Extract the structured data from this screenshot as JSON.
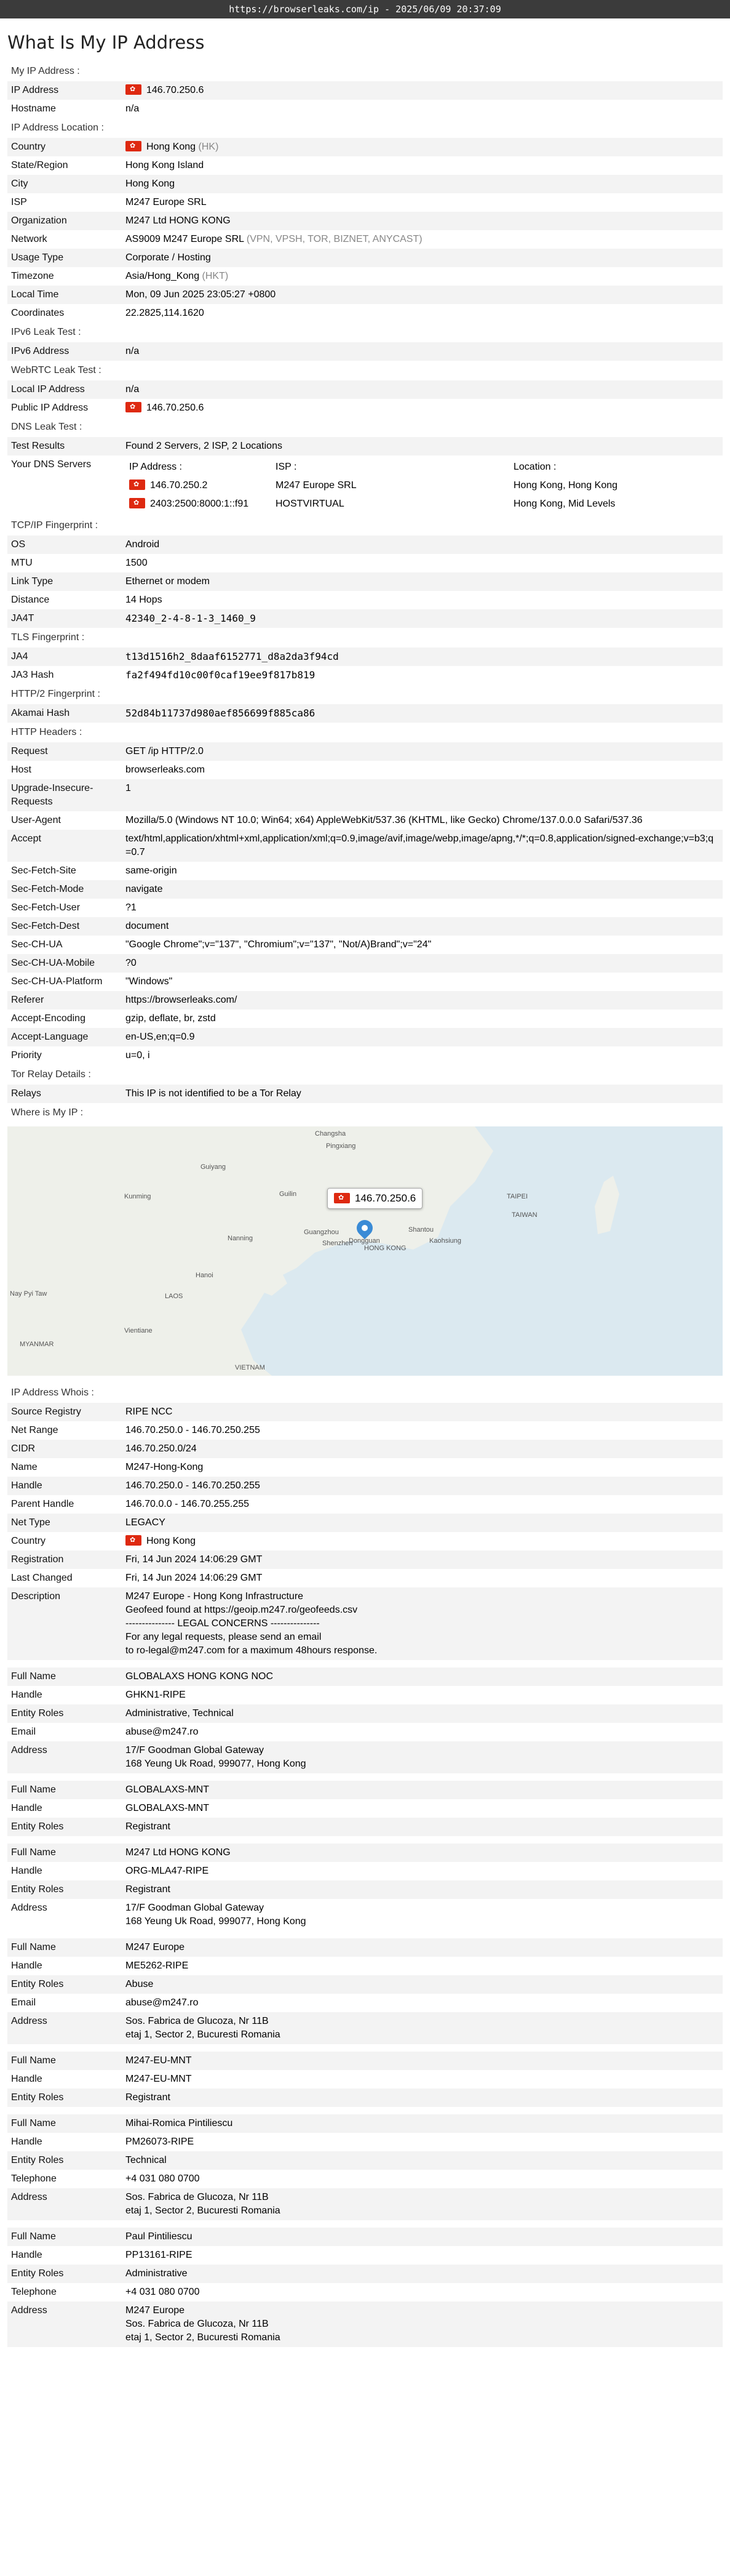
{
  "url_bar": "https://browserleaks.com/ip - 2025/06/09 20:37:09",
  "title": "What Is My IP Address",
  "s_myip": {
    "title": "My IP Address :",
    "ip_label": "IP Address",
    "ip": "146.70.250.6",
    "host_label": "Hostname",
    "host": "n/a"
  },
  "s_loc": {
    "title": "IP Address Location :",
    "country_label": "Country",
    "country": "Hong Kong",
    "country_code": "(HK)",
    "state_label": "State/Region",
    "state": "Hong Kong Island",
    "city_label": "City",
    "city": "Hong Kong",
    "isp_label": "ISP",
    "isp": "M247 Europe SRL",
    "org_label": "Organization",
    "org": "M247 Ltd HONG KONG",
    "net_label": "Network",
    "net": "AS9009 M247 Europe SRL",
    "net_tags": "(VPN, VPSH, TOR, BIZNET, ANYCAST)",
    "usage_label": "Usage Type",
    "usage": "Corporate / Hosting",
    "tz_label": "Timezone",
    "tz": "Asia/Hong_Kong",
    "tz_abbr": "(HKT)",
    "lt_label": "Local Time",
    "lt": "Mon, 09 Jun 2025 23:05:27 +0800",
    "coord_label": "Coordinates",
    "coord": "22.2825,114.1620"
  },
  "s_v6": {
    "title": "IPv6 Leak Test :",
    "label": "IPv6 Address",
    "value": "n/a"
  },
  "s_rtc": {
    "title": "WebRTC Leak Test :",
    "local_label": "Local IP Address",
    "local": "n/a",
    "public_label": "Public IP Address",
    "public": "146.70.250.6"
  },
  "s_dns": {
    "title": "DNS Leak Test :",
    "results_label": "Test Results",
    "results": "Found 2 Servers, 2 ISP, 2 Locations",
    "servers_label": "Your DNS Servers",
    "h_ip": "IP Address :",
    "h_isp": "ISP :",
    "h_loc": "Location :",
    "rows": [
      {
        "ip": "146.70.250.2",
        "isp": "M247 Europe SRL",
        "loc": "Hong Kong, Hong Kong"
      },
      {
        "ip": "2403:2500:8000:1::f91",
        "isp": "HOSTVIRTUAL",
        "loc": "Hong Kong, Mid Levels"
      }
    ]
  },
  "s_tcp": {
    "title": "TCP/IP Fingerprint :",
    "os_label": "OS",
    "os": "Android",
    "mtu_label": "MTU",
    "mtu": "1500",
    "link_label": "Link Type",
    "link": "Ethernet or modem",
    "dist_label": "Distance",
    "dist": "14 Hops",
    "ja4t_label": "JA4T",
    "ja4t": "42340_2-4-8-1-3_1460_9"
  },
  "s_tls": {
    "title": "TLS Fingerprint :",
    "ja4_label": "JA4",
    "ja4": "t13d1516h2_8daaf6152771_d8a2da3f94cd",
    "ja3_label": "JA3 Hash",
    "ja3": "fa2f494fd10c00f0caf19ee9f817b819"
  },
  "s_http2": {
    "title": "HTTP/2 Fingerprint :",
    "label": "Akamai Hash",
    "value": "52d84b11737d980aef856699f885ca86"
  },
  "s_headers": {
    "title": "HTTP Headers :",
    "rows": [
      {
        "k": "Request",
        "v": "GET /ip HTTP/2.0"
      },
      {
        "k": "Host",
        "v": "browserleaks.com"
      },
      {
        "k": "Upgrade-Insecure-Requests",
        "v": "1"
      },
      {
        "k": "User-Agent",
        "v": "Mozilla/5.0 (Windows NT 10.0; Win64; x64) AppleWebKit/537.36 (KHTML, like Gecko) Chrome/137.0.0.0 Safari/537.36"
      },
      {
        "k": "Accept",
        "v": "text/html,application/xhtml+xml,application/xml;q=0.9,image/avif,image/webp,image/apng,*/*;q=0.8,application/signed-exchange;v=b3;q=0.7"
      },
      {
        "k": "Sec-Fetch-Site",
        "v": "same-origin"
      },
      {
        "k": "Sec-Fetch-Mode",
        "v": "navigate"
      },
      {
        "k": "Sec-Fetch-User",
        "v": "?1"
      },
      {
        "k": "Sec-Fetch-Dest",
        "v": "document"
      },
      {
        "k": "Sec-CH-UA",
        "v": "\"Google Chrome\";v=\"137\", \"Chromium\";v=\"137\", \"Not/A)Brand\";v=\"24\""
      },
      {
        "k": "Sec-CH-UA-Mobile",
        "v": "?0"
      },
      {
        "k": "Sec-CH-UA-Platform",
        "v": "\"Windows\""
      },
      {
        "k": "Referer",
        "v": "https://browserleaks.com/"
      },
      {
        "k": "Accept-Encoding",
        "v": "gzip, deflate, br, zstd"
      },
      {
        "k": "Accept-Language",
        "v": "en-US,en;q=0.9"
      },
      {
        "k": "Priority",
        "v": "u=0, i"
      }
    ]
  },
  "s_tor": {
    "title": "Tor Relay Details :",
    "label": "Relays",
    "value": "This IP is not identified to be a Tor Relay"
  },
  "s_map": {
    "title": "Where is My IP :",
    "popup": "146.70.250.6",
    "labels": [
      "Changsha",
      "Pingxiang",
      "Guiyang",
      "Kunming",
      "Guilin",
      "Nanning",
      "Guangzhou",
      "Dongguan",
      "Shenzhen",
      "HONG KONG",
      "Shantou",
      "TAIPEI",
      "TAIWAN",
      "Kaohsiung",
      "Hanoi",
      "LAOS",
      "Vientiane",
      "MYANMAR",
      "VIETNAM",
      "Nay Pyi Taw"
    ]
  },
  "s_whois": {
    "title": "IP Address Whois :",
    "groups": [
      [
        {
          "k": "Source Registry",
          "v": "RIPE NCC"
        },
        {
          "k": "Net Range",
          "v": "146.70.250.0 - 146.70.250.255"
        },
        {
          "k": "CIDR",
          "v": "146.70.250.0/24"
        },
        {
          "k": "Name",
          "v": "M247-Hong-Kong"
        },
        {
          "k": "Handle",
          "v": "146.70.250.0 - 146.70.250.255"
        },
        {
          "k": "Parent Handle",
          "v": "146.70.0.0 - 146.70.255.255"
        },
        {
          "k": "Net Type",
          "v": "LEGACY"
        },
        {
          "k": "Country",
          "v": "Hong Kong",
          "flag": true
        },
        {
          "k": "Registration",
          "v": "Fri, 14 Jun 2024 14:06:29 GMT"
        },
        {
          "k": "Last Changed",
          "v": "Fri, 14 Jun 2024 14:06:29 GMT"
        },
        {
          "k": "Description",
          "v": "M247 Europe - Hong Kong Infrastructure\nGeofeed found at https://geoip.m247.ro/geofeeds.csv\n--------------- LEGAL CONCERNS ---------------\nFor any legal requests, please send an email\nto ro-legal@m247.com for a maximum 48hours response."
        }
      ],
      [
        {
          "k": "Full Name",
          "v": "GLOBALAXS HONG KONG NOC"
        },
        {
          "k": "Handle",
          "v": "GHKN1-RIPE"
        },
        {
          "k": "Entity Roles",
          "v": "Administrative, Technical"
        },
        {
          "k": "Email",
          "v": "abuse@m247.ro"
        },
        {
          "k": "Address",
          "v": "17/F Goodman Global Gateway\n168 Yeung Uk Road, 999077, Hong Kong"
        }
      ],
      [
        {
          "k": "Full Name",
          "v": "GLOBALAXS-MNT"
        },
        {
          "k": "Handle",
          "v": "GLOBALAXS-MNT"
        },
        {
          "k": "Entity Roles",
          "v": "Registrant"
        }
      ],
      [
        {
          "k": "Full Name",
          "v": "M247 Ltd HONG KONG"
        },
        {
          "k": "Handle",
          "v": "ORG-MLA47-RIPE"
        },
        {
          "k": "Entity Roles",
          "v": "Registrant"
        },
        {
          "k": "Address",
          "v": "17/F Goodman Global Gateway\n168 Yeung Uk Road, 999077, Hong Kong"
        }
      ],
      [
        {
          "k": "Full Name",
          "v": "M247 Europe"
        },
        {
          "k": "Handle",
          "v": "ME5262-RIPE"
        },
        {
          "k": "Entity Roles",
          "v": "Abuse"
        },
        {
          "k": "Email",
          "v": "abuse@m247.ro"
        },
        {
          "k": "Address",
          "v": "Sos. Fabrica de Glucoza, Nr 11B\netaj 1, Sector 2, Bucuresti Romania"
        }
      ],
      [
        {
          "k": "Full Name",
          "v": "M247-EU-MNT"
        },
        {
          "k": "Handle",
          "v": "M247-EU-MNT"
        },
        {
          "k": "Entity Roles",
          "v": "Registrant"
        }
      ],
      [
        {
          "k": "Full Name",
          "v": "Mihai-Romica Pintiliescu"
        },
        {
          "k": "Handle",
          "v": "PM26073-RIPE"
        },
        {
          "k": "Entity Roles",
          "v": "Technical"
        },
        {
          "k": "Telephone",
          "v": "+4 031 080 0700"
        },
        {
          "k": "Address",
          "v": "Sos. Fabrica de Glucoza, Nr 11B\netaj 1, Sector 2, Bucuresti Romania"
        }
      ],
      [
        {
          "k": "Full Name",
          "v": "Paul Pintiliescu"
        },
        {
          "k": "Handle",
          "v": "PP13161-RIPE"
        },
        {
          "k": "Entity Roles",
          "v": "Administrative"
        },
        {
          "k": "Telephone",
          "v": "+4 031 080 0700"
        },
        {
          "k": "Address",
          "v": "M247 Europe\nSos. Fabrica de Glucoza, Nr 11B\netaj 1, Sector 2, Bucuresti Romania"
        }
      ]
    ]
  }
}
